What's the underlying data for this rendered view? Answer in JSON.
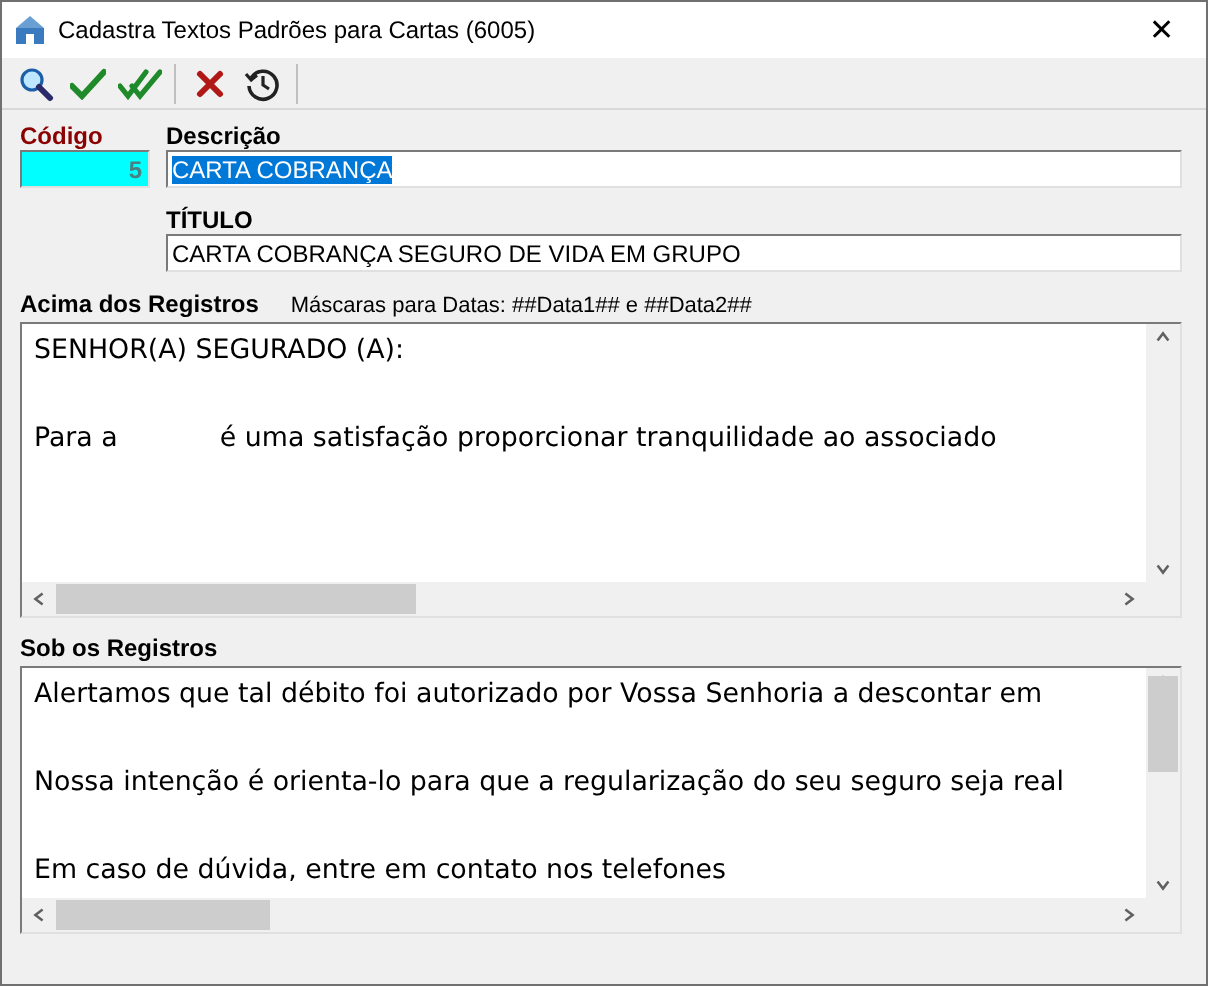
{
  "window": {
    "title": "Cadastra Textos Padrões para Cartas (6005)",
    "close": "✕"
  },
  "toolbar": {
    "buttons": [
      {
        "kind": "search"
      },
      {
        "kind": "check"
      },
      {
        "kind": "double-check"
      },
      {
        "kind": "separator"
      },
      {
        "kind": "cancel"
      },
      {
        "kind": "history"
      }
    ]
  },
  "fields": {
    "codigo": {
      "label": "Código",
      "value": "5"
    },
    "descricao": {
      "label": "Descrição",
      "value": "CARTA COBRANÇA",
      "selected": true
    },
    "titulo": {
      "label": "TÍTULO",
      "value": "CARTA COBRANÇA SEGURO DE VIDA EM GRUPO"
    }
  },
  "acima": {
    "label": "Acima dos Registros",
    "hint": "Máscaras para Datas: ##Data1## e ##Data2##",
    "lines": [
      "SENHOR(A) SEGURADO (A):",
      "Para a            é uma satisfação proporcionar tranquilidade ao associado"
    ]
  },
  "sob": {
    "label": "Sob os Registros",
    "lines": [
      "Alertamos que tal débito foi autorizado por Vossa Senhoria a descontar em",
      "Nossa intenção é orienta-lo para que a regularização do seu seguro seja real",
      "Em caso de dúvida, entre em contato nos telefones"
    ]
  }
}
